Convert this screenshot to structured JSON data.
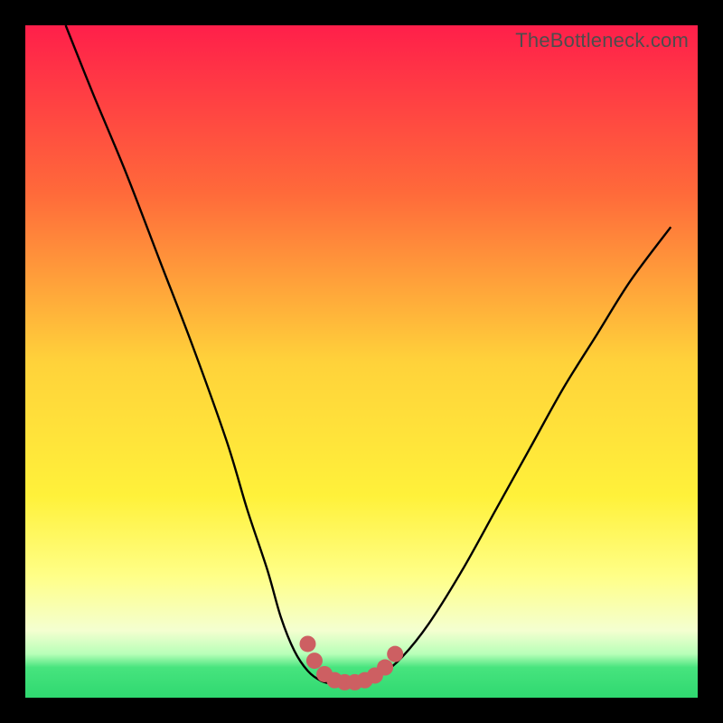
{
  "watermark": "TheBottleneck.com",
  "colors": {
    "frame": "#000000",
    "curve": "#000000",
    "markers": "#cd5f62",
    "green_band": "#3fe27a"
  },
  "chart_data": {
    "type": "line",
    "title": "",
    "xlabel": "",
    "ylabel": "",
    "xlim": [
      0,
      100
    ],
    "ylim": [
      0,
      100
    ],
    "gradient_stops": [
      {
        "offset": 0.0,
        "color": "#ff1f4a"
      },
      {
        "offset": 0.25,
        "color": "#ff6a3a"
      },
      {
        "offset": 0.5,
        "color": "#ffd23a"
      },
      {
        "offset": 0.7,
        "color": "#fff13a"
      },
      {
        "offset": 0.82,
        "color": "#ffff88"
      },
      {
        "offset": 0.9,
        "color": "#f4ffd0"
      },
      {
        "offset": 0.935,
        "color": "#b8ffb8"
      },
      {
        "offset": 0.955,
        "color": "#47e47e"
      },
      {
        "offset": 1.0,
        "color": "#2fd870"
      }
    ],
    "series": [
      {
        "name": "bottleneck-curve",
        "x": [
          6,
          10,
          15,
          20,
          25,
          30,
          33,
          36,
          38,
          40,
          42,
          44,
          46,
          48,
          50,
          53,
          56,
          60,
          65,
          70,
          75,
          80,
          85,
          90,
          96
        ],
        "y": [
          100,
          90,
          78,
          65,
          52,
          38,
          28,
          19,
          12,
          7,
          4,
          2.5,
          2,
          2,
          2.2,
          3.5,
          6,
          11,
          19,
          28,
          37,
          46,
          54,
          62,
          70
        ]
      }
    ],
    "markers": {
      "name": "highlight-dots",
      "x": [
        42,
        43,
        44.5,
        46,
        47.5,
        49,
        50.5,
        52,
        53.5,
        55
      ],
      "y": [
        8,
        5.5,
        3.5,
        2.6,
        2.3,
        2.3,
        2.6,
        3.3,
        4.5,
        6.5
      ],
      "r": 9
    }
  }
}
